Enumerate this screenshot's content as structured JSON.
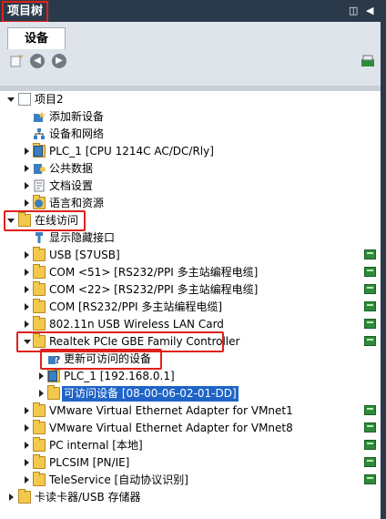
{
  "window": {
    "title": "项目树"
  },
  "tabs": [
    {
      "label": "设备",
      "active": true
    }
  ],
  "toolbar": {
    "buttons": [
      "new-item-icon",
      "back-icon",
      "forward-icon",
      "settings-icon"
    ]
  },
  "tree": {
    "root": "项目2",
    "items": [
      "添加新设备",
      "设备和网络",
      "PLC_1 [CPU 1214C AC/DC/Rly]",
      "公共数据",
      "文档设置",
      "语言和资源",
      "在线访问",
      "显示隐藏接口",
      "USB [S7USB]",
      "COM <51> [RS232/PPI 多主站编程电缆]",
      "COM <22> [RS232/PPI 多主站编程电缆]",
      "COM [RS232/PPI 多主站编程电缆]",
      "802.11n USB Wireless LAN Card",
      "Realtek PCIe GBE Family Controller",
      "更新可访问的设备",
      "PLC_1 [192.168.0.1]",
      "可访问设备 [08-00-06-02-01-DD]",
      "VMware Virtual Ethernet Adapter for VMnet1",
      "VMware Virtual Ethernet Adapter for VMnet8",
      "PC internal [本地]",
      "PLCSIM [PN/IE]",
      "TeleService [自动协议识别]",
      "卡读卡器/USB 存储器"
    ]
  },
  "colors": {
    "title_bg": "#2b3a4a",
    "highlight": "#1f64c8",
    "annotation": "#e0201c",
    "status": "#2e8b3a"
  }
}
